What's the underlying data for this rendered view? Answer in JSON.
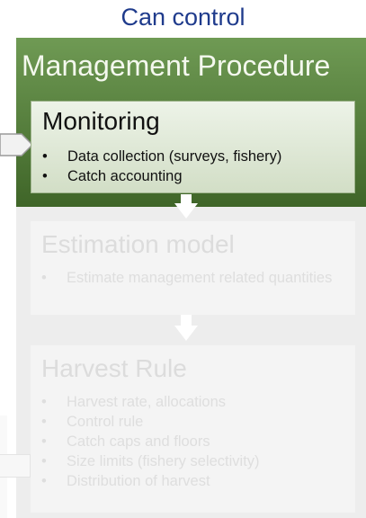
{
  "heading": "Can control",
  "management": {
    "title": "Management Procedure"
  },
  "monitoring": {
    "title": "Monitoring",
    "items": [
      "Data collection (surveys, fishery)",
      "Catch accounting"
    ]
  },
  "estimation": {
    "title": "Estimation model",
    "items": [
      "Estimate management related quantities"
    ]
  },
  "harvest": {
    "title": "Harvest Rule",
    "items": [
      "Harvest rate, allocations",
      "Control rule",
      "Catch caps and floors",
      "Size limits (fishery selectivity)",
      "Distribution of harvest"
    ]
  },
  "colors": {
    "heading_blue": "#1f3b8c",
    "management_green": "#4f7a35",
    "faded_text": "#dedede"
  }
}
